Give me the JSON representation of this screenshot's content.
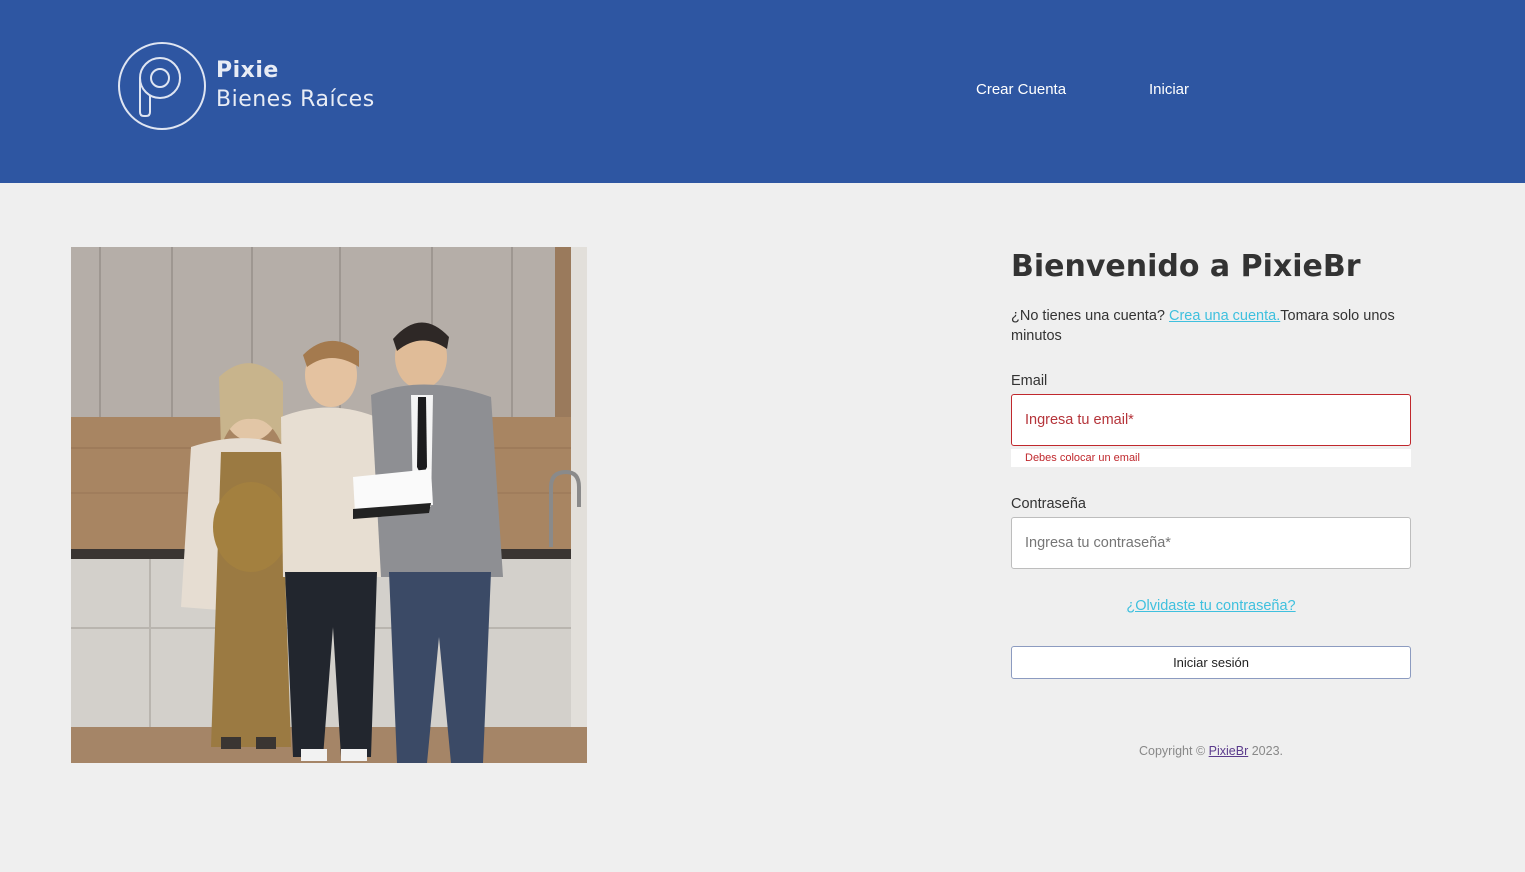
{
  "header": {
    "logo": {
      "line1": "Pixie",
      "line2": "Bienes Raíces",
      "icon": "pixie-p-circle-logo"
    },
    "nav": {
      "create_account": "Crear Cuenta",
      "login": "Iniciar"
    },
    "background_color": "#2e56a2"
  },
  "photo": {
    "alt": "Pareja con agente inmobiliario revisando documentos en una cocina"
  },
  "login_form": {
    "title": "Bienvenido a PixieBr",
    "signup_prefix": "¿No tienes una cuenta? ",
    "signup_link": "Crea una cuenta.",
    "signup_suffix": "Tomara solo unos minutos",
    "email_label": "Email",
    "email_placeholder": "Ingresa tu email*",
    "email_value": "",
    "email_error": "Debes colocar un email",
    "password_label": "Contraseña",
    "password_placeholder": "Ingresa tu contraseña*",
    "password_value": "",
    "forgot_link": "¿Olvidaste tu contraseña?",
    "submit_label": "Iniciar sesión"
  },
  "footer": {
    "copyright_prefix": "Copyright © ",
    "copyright_link": "PixieBr",
    "copyright_suffix": " 2023."
  },
  "colors": {
    "header_bg": "#2e56a2",
    "page_bg": "#efefef",
    "link": "#3fc0de",
    "error": "#c0282d"
  }
}
